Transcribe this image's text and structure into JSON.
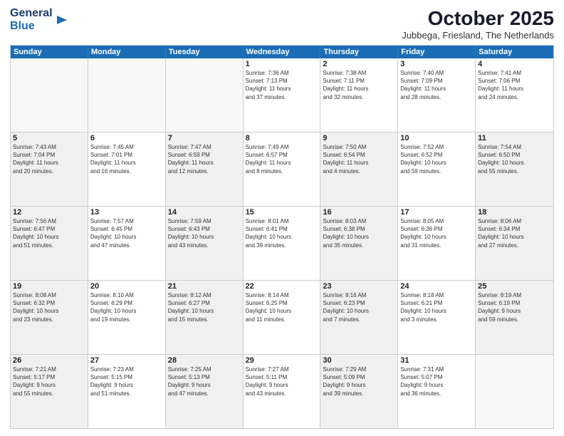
{
  "logo": {
    "line1": "General",
    "line2": "Blue",
    "arrow": "▶"
  },
  "title": "October 2025",
  "subtitle": "Jubbega, Friesland, The Netherlands",
  "days_of_week": [
    "Sunday",
    "Monday",
    "Tuesday",
    "Wednesday",
    "Thursday",
    "Friday",
    "Saturday"
  ],
  "weeks": [
    [
      {
        "day": "",
        "data": "",
        "shaded": true
      },
      {
        "day": "",
        "data": "",
        "shaded": true
      },
      {
        "day": "",
        "data": "",
        "shaded": true
      },
      {
        "day": "1",
        "data": "Sunrise: 7:36 AM\nSunset: 7:13 PM\nDaylight: 11 hours\nand 37 minutes.",
        "shaded": false
      },
      {
        "day": "2",
        "data": "Sunrise: 7:38 AM\nSunset: 7:11 PM\nDaylight: 11 hours\nand 32 minutes.",
        "shaded": false
      },
      {
        "day": "3",
        "data": "Sunrise: 7:40 AM\nSunset: 7:09 PM\nDaylight: 11 hours\nand 28 minutes.",
        "shaded": false
      },
      {
        "day": "4",
        "data": "Sunrise: 7:41 AM\nSunset: 7:06 PM\nDaylight: 11 hours\nand 24 minutes.",
        "shaded": false
      }
    ],
    [
      {
        "day": "5",
        "data": "Sunrise: 7:43 AM\nSunset: 7:04 PM\nDaylight: 11 hours\nand 20 minutes.",
        "shaded": true
      },
      {
        "day": "6",
        "data": "Sunrise: 7:45 AM\nSunset: 7:01 PM\nDaylight: 11 hours\nand 16 minutes.",
        "shaded": false
      },
      {
        "day": "7",
        "data": "Sunrise: 7:47 AM\nSunset: 6:59 PM\nDaylight: 11 hours\nand 12 minutes.",
        "shaded": true
      },
      {
        "day": "8",
        "data": "Sunrise: 7:49 AM\nSunset: 6:57 PM\nDaylight: 11 hours\nand 8 minutes.",
        "shaded": false
      },
      {
        "day": "9",
        "data": "Sunrise: 7:50 AM\nSunset: 6:54 PM\nDaylight: 11 hours\nand 4 minutes.",
        "shaded": true
      },
      {
        "day": "10",
        "data": "Sunrise: 7:52 AM\nSunset: 6:52 PM\nDaylight: 10 hours\nand 59 minutes.",
        "shaded": false
      },
      {
        "day": "11",
        "data": "Sunrise: 7:54 AM\nSunset: 6:50 PM\nDaylight: 10 hours\nand 55 minutes.",
        "shaded": true
      }
    ],
    [
      {
        "day": "12",
        "data": "Sunrise: 7:56 AM\nSunset: 6:47 PM\nDaylight: 10 hours\nand 51 minutes.",
        "shaded": true
      },
      {
        "day": "13",
        "data": "Sunrise: 7:57 AM\nSunset: 6:45 PM\nDaylight: 10 hours\nand 47 minutes.",
        "shaded": false
      },
      {
        "day": "14",
        "data": "Sunrise: 7:59 AM\nSunset: 6:43 PM\nDaylight: 10 hours\nand 43 minutes.",
        "shaded": true
      },
      {
        "day": "15",
        "data": "Sunrise: 8:01 AM\nSunset: 6:41 PM\nDaylight: 10 hours\nand 39 minutes.",
        "shaded": false
      },
      {
        "day": "16",
        "data": "Sunrise: 8:03 AM\nSunset: 6:38 PM\nDaylight: 10 hours\nand 35 minutes.",
        "shaded": true
      },
      {
        "day": "17",
        "data": "Sunrise: 8:05 AM\nSunset: 6:36 PM\nDaylight: 10 hours\nand 31 minutes.",
        "shaded": false
      },
      {
        "day": "18",
        "data": "Sunrise: 8:06 AM\nSunset: 6:34 PM\nDaylight: 10 hours\nand 27 minutes.",
        "shaded": true
      }
    ],
    [
      {
        "day": "19",
        "data": "Sunrise: 8:08 AM\nSunset: 6:32 PM\nDaylight: 10 hours\nand 23 minutes.",
        "shaded": true
      },
      {
        "day": "20",
        "data": "Sunrise: 8:10 AM\nSunset: 6:29 PM\nDaylight: 10 hours\nand 19 minutes.",
        "shaded": false
      },
      {
        "day": "21",
        "data": "Sunrise: 8:12 AM\nSunset: 6:27 PM\nDaylight: 10 hours\nand 15 minutes.",
        "shaded": true
      },
      {
        "day": "22",
        "data": "Sunrise: 8:14 AM\nSunset: 6:25 PM\nDaylight: 10 hours\nand 11 minutes.",
        "shaded": false
      },
      {
        "day": "23",
        "data": "Sunrise: 8:16 AM\nSunset: 6:23 PM\nDaylight: 10 hours\nand 7 minutes.",
        "shaded": true
      },
      {
        "day": "24",
        "data": "Sunrise: 8:18 AM\nSunset: 6:21 PM\nDaylight: 10 hours\nand 3 minutes.",
        "shaded": false
      },
      {
        "day": "25",
        "data": "Sunrise: 8:19 AM\nSunset: 6:19 PM\nDaylight: 9 hours\nand 59 minutes.",
        "shaded": true
      }
    ],
    [
      {
        "day": "26",
        "data": "Sunrise: 7:21 AM\nSunset: 5:17 PM\nDaylight: 9 hours\nand 55 minutes.",
        "shaded": true
      },
      {
        "day": "27",
        "data": "Sunrise: 7:23 AM\nSunset: 5:15 PM\nDaylight: 9 hours\nand 51 minutes.",
        "shaded": false
      },
      {
        "day": "28",
        "data": "Sunrise: 7:25 AM\nSunset: 5:13 PM\nDaylight: 9 hours\nand 47 minutes.",
        "shaded": true
      },
      {
        "day": "29",
        "data": "Sunrise: 7:27 AM\nSunset: 5:11 PM\nDaylight: 9 hours\nand 43 minutes.",
        "shaded": false
      },
      {
        "day": "30",
        "data": "Sunrise: 7:29 AM\nSunset: 5:09 PM\nDaylight: 9 hours\nand 39 minutes.",
        "shaded": true
      },
      {
        "day": "31",
        "data": "Sunrise: 7:31 AM\nSunset: 5:07 PM\nDaylight: 9 hours\nand 36 minutes.",
        "shaded": false
      },
      {
        "day": "",
        "data": "",
        "shaded": true
      }
    ]
  ]
}
